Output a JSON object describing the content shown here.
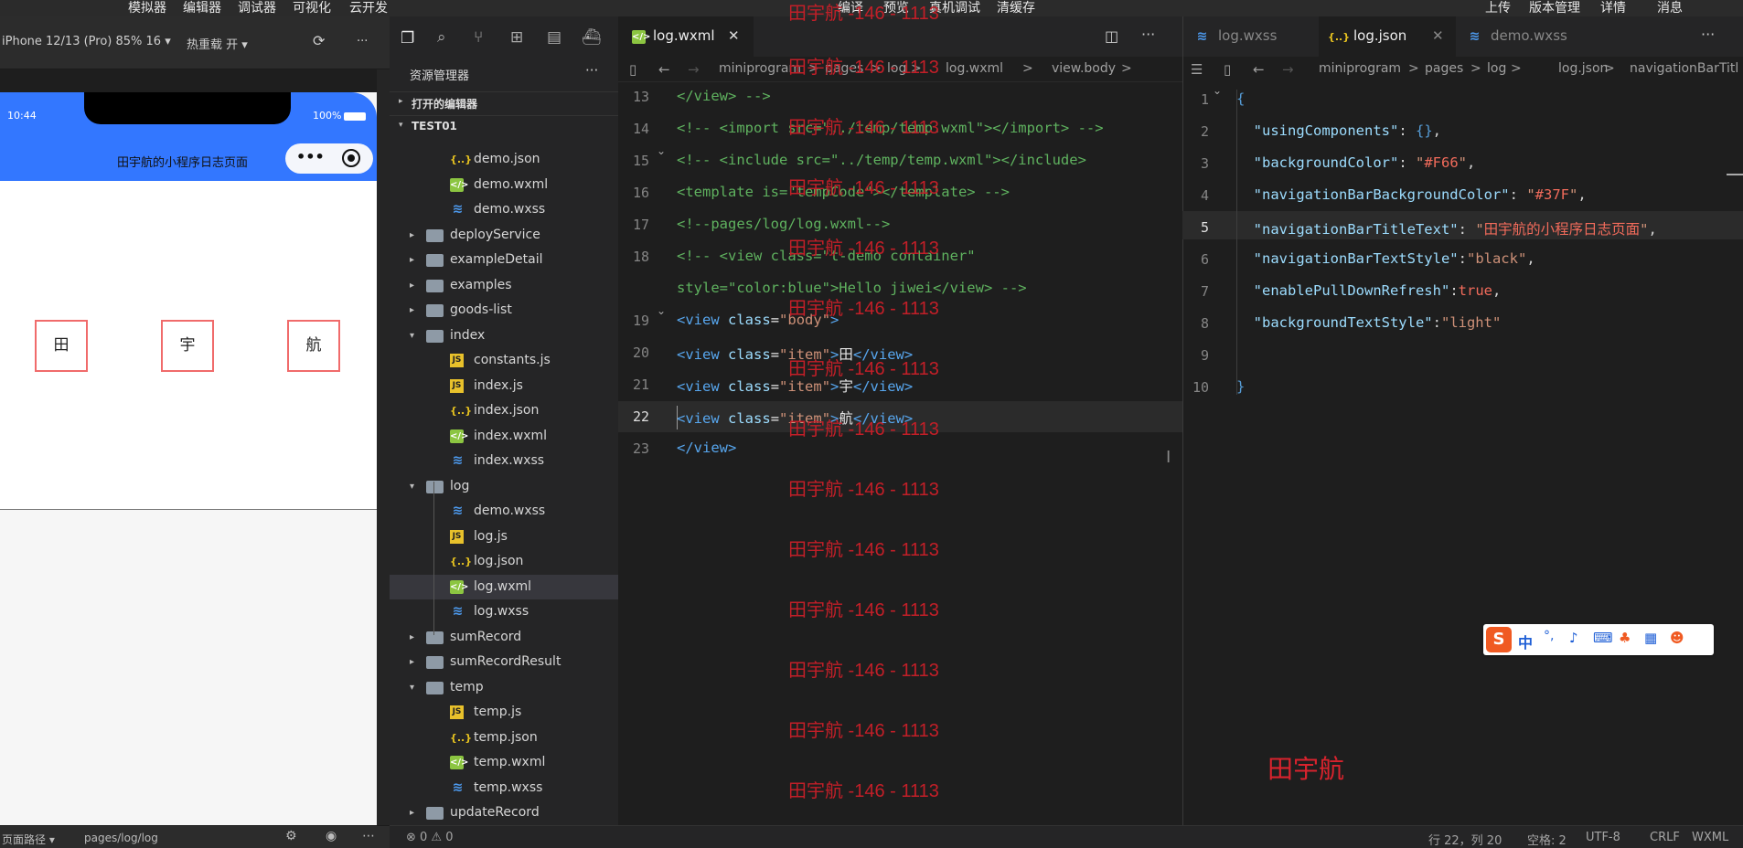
{
  "menubar": {
    "items": [
      "模拟器",
      "编辑器",
      "调试器",
      "可视化",
      "云开发"
    ],
    "right_items": [
      "编译",
      "预览",
      "真机调试",
      "清缓存"
    ],
    "far_right": [
      "上传",
      "版本管理",
      "详情",
      "消息"
    ]
  },
  "simulator": {
    "device": "iPhone 12/13 (Pro) 85% 16 ▾",
    "hot_reload": "热重载 开 ▾",
    "time": "10:44",
    "battery": "100%",
    "nav_title": "田宇航的小程序日志页面",
    "items": [
      "田",
      "宇",
      "航"
    ],
    "path_label": "页面路径 ▾",
    "path": "pages/log/log"
  },
  "explorer": {
    "title": "资源管理器",
    "open_editors": "打开的编辑器",
    "project": "TEST01",
    "rows": [
      {
        "label": "demo.json",
        "type": "json",
        "depth": 2
      },
      {
        "label": "demo.wxml",
        "type": "wxml",
        "depth": 2
      },
      {
        "label": "demo.wxss",
        "type": "wxss",
        "depth": 2
      },
      {
        "label": "deployService",
        "type": "folder",
        "depth": 1,
        "arrow": "▸"
      },
      {
        "label": "exampleDetail",
        "type": "folder",
        "depth": 1,
        "arrow": "▸"
      },
      {
        "label": "examples",
        "type": "folder",
        "depth": 1,
        "arrow": "▸"
      },
      {
        "label": "goods-list",
        "type": "folder",
        "depth": 1,
        "arrow": "▸"
      },
      {
        "label": "index",
        "type": "folder",
        "depth": 1,
        "arrow": "▾"
      },
      {
        "label": "constants.js",
        "type": "js",
        "depth": 2
      },
      {
        "label": "index.js",
        "type": "js",
        "depth": 2
      },
      {
        "label": "index.json",
        "type": "json",
        "depth": 2
      },
      {
        "label": "index.wxml",
        "type": "wxml",
        "depth": 2
      },
      {
        "label": "index.wxss",
        "type": "wxss",
        "depth": 2
      },
      {
        "label": "log",
        "type": "folder",
        "depth": 1,
        "arrow": "▾"
      },
      {
        "label": "demo.wxss",
        "type": "wxss",
        "depth": 2
      },
      {
        "label": "log.js",
        "type": "js",
        "depth": 2
      },
      {
        "label": "log.json",
        "type": "json",
        "depth": 2
      },
      {
        "label": "log.wxml",
        "type": "wxml",
        "depth": 2,
        "selected": true
      },
      {
        "label": "log.wxss",
        "type": "wxss",
        "depth": 2
      },
      {
        "label": "sumRecord",
        "type": "folder",
        "depth": 1,
        "arrow": "▸"
      },
      {
        "label": "sumRecordResult",
        "type": "folder",
        "depth": 1,
        "arrow": "▸"
      },
      {
        "label": "temp",
        "type": "folder",
        "depth": 1,
        "arrow": "▾"
      },
      {
        "label": "temp.js",
        "type": "js",
        "depth": 2
      },
      {
        "label": "temp.json",
        "type": "json",
        "depth": 2
      },
      {
        "label": "temp.wxml",
        "type": "wxml",
        "depth": 2
      },
      {
        "label": "temp.wxss",
        "type": "wxss",
        "depth": 2
      },
      {
        "label": "updateRecord",
        "type": "folder",
        "depth": 1,
        "arrow": "▸"
      }
    ]
  },
  "editor1": {
    "tab": "log.wxml",
    "breadcrumb": [
      "miniprogram",
      ">",
      "pages",
      ">",
      "log",
      ">",
      "log.wxml",
      ">",
      "view.body",
      ">"
    ],
    "watermark": "田宇航 -146 - 1113",
    "line_numbers": [
      "13",
      "14",
      "15",
      "16",
      "17",
      "18",
      "",
      "19",
      "20",
      "21",
      "22",
      "23"
    ]
  },
  "editor2": {
    "tabs": [
      "log.wxss",
      "log.json",
      "demo.wxss"
    ],
    "breadcrumb": [
      "miniprogram",
      ">",
      "pages",
      ">",
      "log",
      ">",
      "log.json",
      ">",
      "navigationBarTitleT"
    ],
    "line_numbers": [
      "1",
      "2",
      "3",
      "4",
      "5",
      "6",
      "7",
      "8",
      "9",
      "10"
    ],
    "signature": "田宇航"
  },
  "statusbar": {
    "problems": "⊗ 0 ⚠ 0",
    "position": "行 22，列 20",
    "spaces": "空格: 2",
    "encoding": "UTF-8",
    "eol": "CRLF",
    "language": "WXML"
  },
  "ime": {
    "lang": "中"
  }
}
